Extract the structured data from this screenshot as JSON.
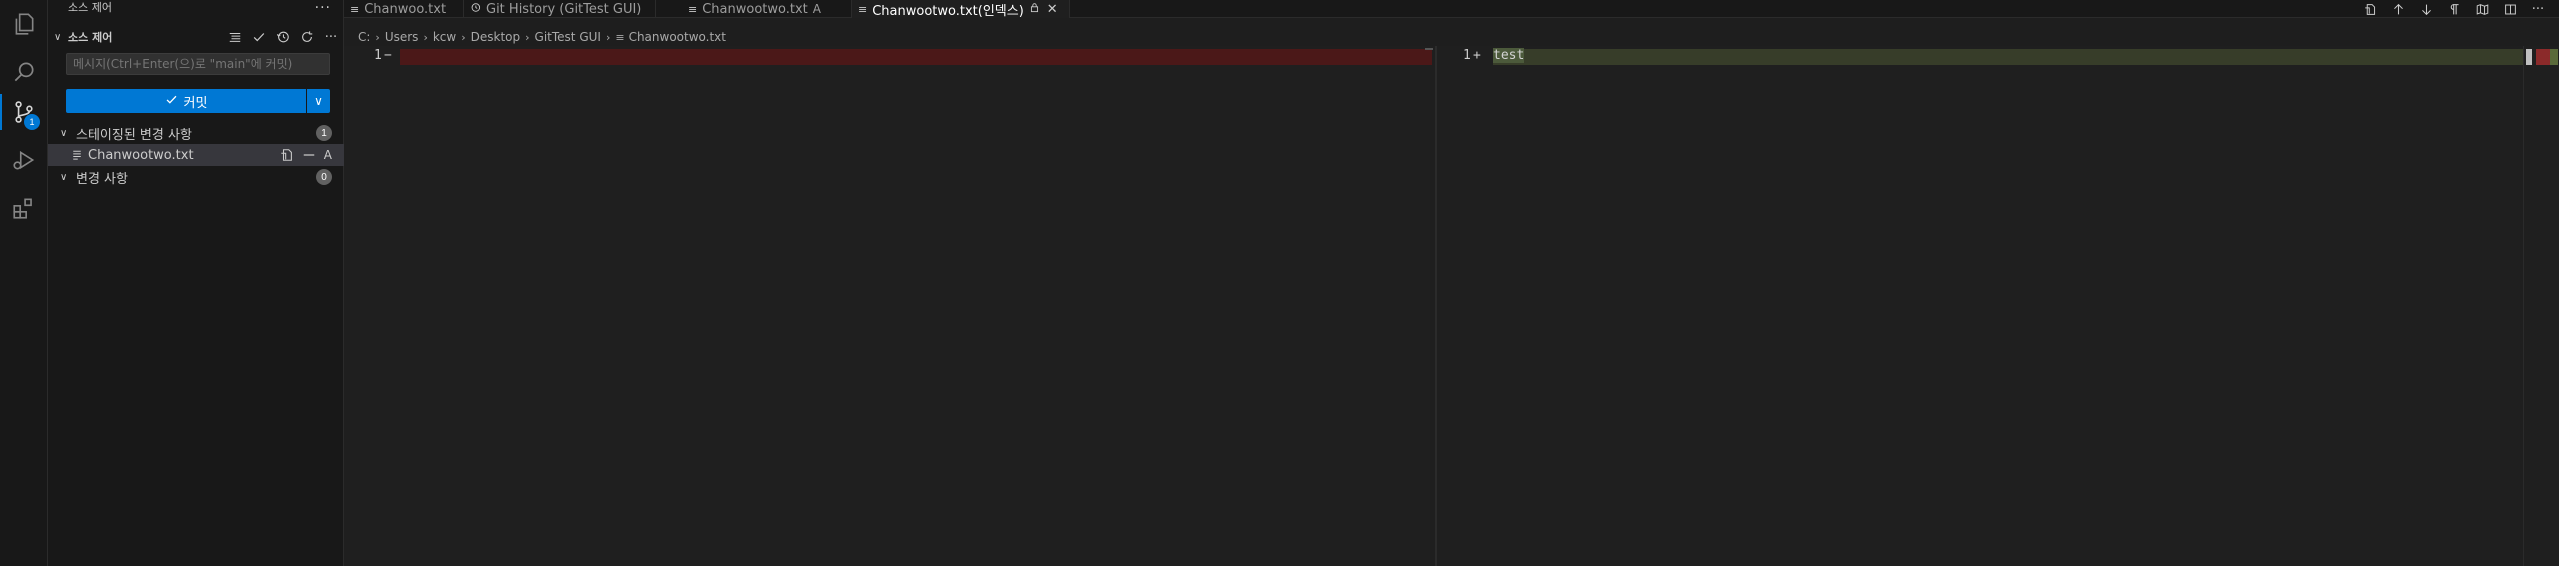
{
  "activity_bar": {
    "icons": [
      "explorer-icon",
      "search-icon",
      "source-control-icon",
      "run-debug-icon",
      "extensions-icon"
    ],
    "scm_badge": "1",
    "accent": "#0078d4"
  },
  "sidebar": {
    "title": "소스 제어",
    "title_more": "···",
    "section_header": "소스 제어",
    "message_placeholder": "메시지(Ctrl+Enter(으)로 \"main\"에 커밋)",
    "commit_label": "커밋",
    "staged_group": {
      "label": "스테이징된 변경 사항",
      "count": "1",
      "files": [
        {
          "name": "Chanwootwo.txt",
          "status": "A"
        }
      ]
    },
    "changes_group": {
      "label": "변경 사항",
      "count": "0"
    }
  },
  "tabs": [
    {
      "label": "Chanwoo.txt",
      "decoration": ""
    },
    {
      "label": "Git History (GitTest GUI)",
      "decoration": ""
    },
    {
      "label": "Chanwootwo.txt",
      "decoration": "A"
    },
    {
      "label": "Chanwootwo.txt(인덱스)",
      "decoration": ""
    }
  ],
  "breadcrumb": {
    "parts": [
      "C:",
      "Users",
      "kcw",
      "Desktop",
      "GitTest GUI",
      "Chanwootwo.txt"
    ]
  },
  "diff": {
    "left": {
      "line_number": "1",
      "marker": "−"
    },
    "right": {
      "line_number": "1",
      "marker": "+",
      "text": "test"
    }
  },
  "colors": {
    "deleted_line": "#4b1818",
    "added_line": "#373d29",
    "primary_button": "#0078d4"
  }
}
